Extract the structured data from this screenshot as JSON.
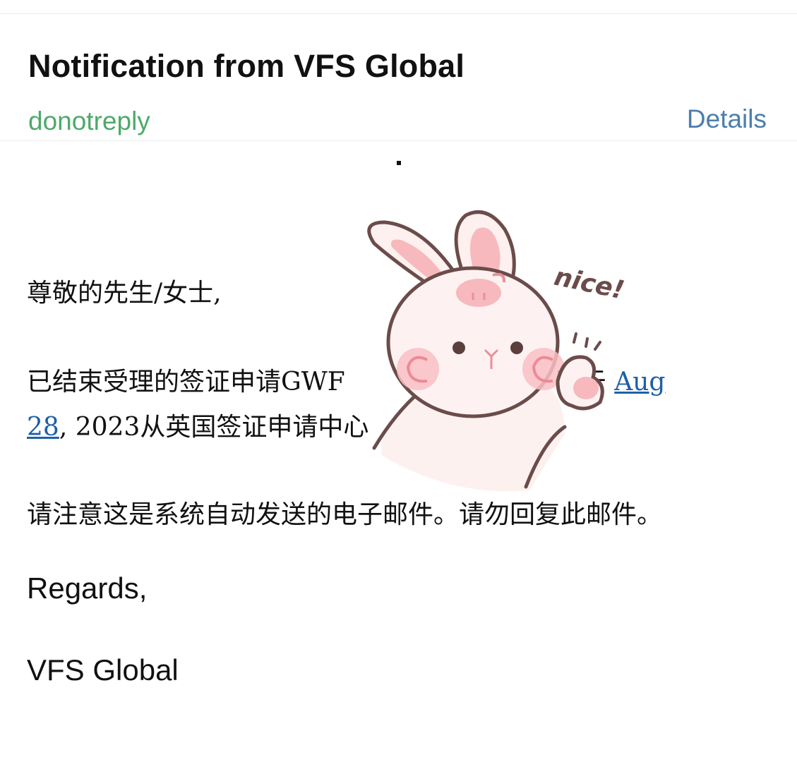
{
  "email": {
    "subject": "Notification from VFS Global",
    "sender": "donotreply",
    "details_label": "Details"
  },
  "body": {
    "greeting": "尊敬的先生/女士,",
    "line1_prefix": "已结束受理的签证申请GWF",
    "line1_suffix": "已于",
    "date_link_part1": "Aug",
    "date_link_part2": "28",
    "line2_rest": ", 2023从英国签证申请中心",
    "note": "请注意这是系统自动发送的电子邮件。请勿回复此邮件。",
    "regards": "Regards,",
    "signoff": "VFS Global"
  },
  "sticker": {
    "caption": "nice!",
    "icon": "bunny-thumbs-up-sticker"
  },
  "colors": {
    "sender": "#4ea96a",
    "details": "#4a7fae",
    "link": "#1f5fa8",
    "text": "#111111"
  }
}
